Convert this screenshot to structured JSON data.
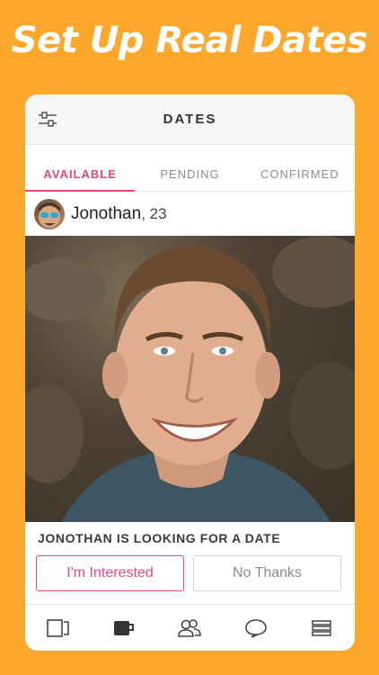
{
  "headline": "Set Up Real Dates",
  "topbar": {
    "title": "DATES",
    "filter_icon": "sliders-icon"
  },
  "tabs": [
    {
      "label": "AVAILABLE",
      "active": true
    },
    {
      "label": "PENDING",
      "active": false
    },
    {
      "label": "CONFIRMED",
      "active": false
    }
  ],
  "profile": {
    "name": "Jonothan",
    "age": ", 23"
  },
  "card": {
    "looking_text": "JONOTHAN IS LOOKING FOR A DATE",
    "interested_label": "I'm Interested",
    "decline_label": "No Thanks"
  },
  "bottom_nav": [
    {
      "icon": "cards-icon",
      "active": false
    },
    {
      "icon": "coffee-cup-icon",
      "active": true
    },
    {
      "icon": "people-icon",
      "active": false
    },
    {
      "icon": "chat-bubble-icon",
      "active": false
    },
    {
      "icon": "menu-icon",
      "active": false
    }
  ],
  "colors": {
    "background": "#FDA82D",
    "accent": "#E8467C",
    "muted": "#8C8C8C"
  }
}
